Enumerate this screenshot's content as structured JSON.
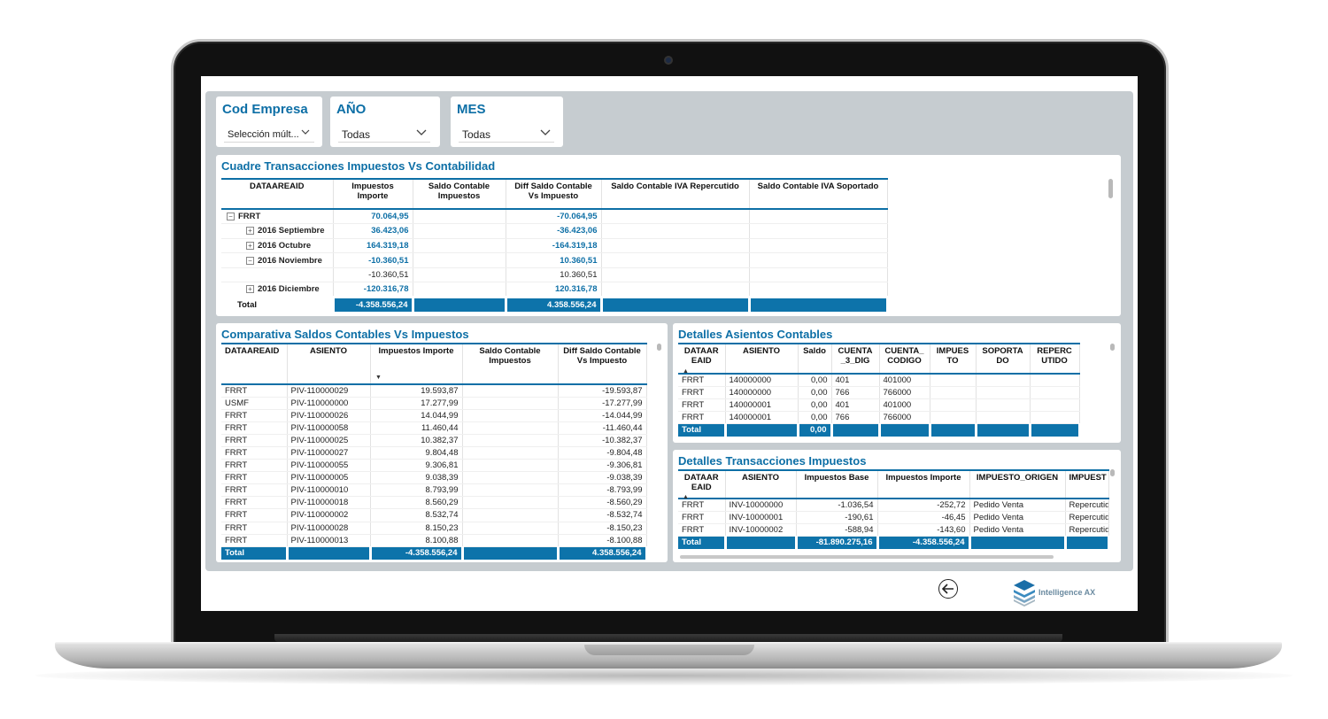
{
  "slicers": {
    "empresa": {
      "title": "Cod Empresa",
      "value": "Selección múlt..."
    },
    "anio": {
      "title": "AÑO",
      "value": "Todas"
    },
    "mes": {
      "title": "MES",
      "value": "Todas"
    }
  },
  "cuadre": {
    "title": "Cuadre Transacciones Impuestos Vs Contabilidad",
    "headers": [
      "DATAAREAID",
      "Impuestos Importe",
      "Saldo Contable Impuestos",
      "Diff Saldo Contable Vs Impuesto",
      "Saldo Contable IVA Repercutido",
      "Saldo Contable IVA Soportado"
    ],
    "rows": [
      {
        "label": "FRRT",
        "expander": "⊟",
        "indent": 0,
        "importe": "70.064,95",
        "diff": "-70.064,95",
        "bold": true
      },
      {
        "label": "2016 Septiembre",
        "expander": "⊞",
        "indent": 1,
        "importe": "36.423,06",
        "diff": "-36.423,06",
        "bold": true
      },
      {
        "label": "2016 Octubre",
        "expander": "⊞",
        "indent": 1,
        "importe": "164.319,18",
        "diff": "-164.319,18",
        "bold": true
      },
      {
        "label": "2016 Noviembre",
        "expander": "⊟",
        "indent": 1,
        "importe": "-10.360,51",
        "diff": "10.360,51",
        "bold": true
      },
      {
        "label": "",
        "expander": "",
        "indent": 2,
        "importe": "-10.360,51",
        "diff": "10.360,51",
        "bold": false
      },
      {
        "label": "2016 Diciembre",
        "expander": "⊞",
        "indent": 1,
        "importe": "-120.316,78",
        "diff": "120.316,78",
        "bold": true
      }
    ],
    "total": {
      "label": "Total",
      "importe": "-4.358.556,24",
      "diff": "4.358.556,24"
    }
  },
  "comparativa": {
    "title": "Comparativa Saldos Contables Vs Impuestos",
    "headers": [
      "DATAAREAID",
      "ASIENTO",
      "Impuestos Importe",
      "Saldo Contable Impuestos",
      "Diff Saldo Contable Vs Impuesto"
    ],
    "rows": [
      [
        "FRRT",
        "PIV-110000029",
        "19.593,87",
        "",
        "-19.593,87"
      ],
      [
        "USMF",
        "PIV-110000000",
        "17.277,99",
        "",
        "-17.277,99"
      ],
      [
        "FRRT",
        "PIV-110000026",
        "14.044,99",
        "",
        "-14.044,99"
      ],
      [
        "FRRT",
        "PIV-110000058",
        "11.460,44",
        "",
        "-11.460,44"
      ],
      [
        "FRRT",
        "PIV-110000025",
        "10.382,37",
        "",
        "-10.382,37"
      ],
      [
        "FRRT",
        "PIV-110000027",
        "9.804,48",
        "",
        "-9.804,48"
      ],
      [
        "FRRT",
        "PIV-110000055",
        "9.306,81",
        "",
        "-9.306,81"
      ],
      [
        "FRRT",
        "PIV-110000005",
        "9.038,39",
        "",
        "-9.038,39"
      ],
      [
        "FRRT",
        "PIV-110000010",
        "8.793,99",
        "",
        "-8.793,99"
      ],
      [
        "FRRT",
        "PIV-110000018",
        "8.560,29",
        "",
        "-8.560,29"
      ],
      [
        "FRRT",
        "PIV-110000002",
        "8.532,74",
        "",
        "-8.532,74"
      ],
      [
        "FRRT",
        "PIV-110000028",
        "8.150,23",
        "",
        "-8.150,23"
      ],
      [
        "FRRT",
        "PIV-110000013",
        "8.100,88",
        "",
        "-8.100,88"
      ]
    ],
    "total": [
      "Total",
      "",
      "-4.358.556,24",
      "",
      "4.358.556,24"
    ]
  },
  "asientos": {
    "title": "Detalles Asientos Contables",
    "headers": [
      "DATAAR EAID",
      "ASIENTO",
      "Saldo",
      "CUENTA _3_DIG",
      "CUENTA_ CODIGO",
      "IMPUES TO",
      "SOPORTA DO",
      "REPERC UTIDO"
    ],
    "rows": [
      [
        "FRRT",
        "140000000",
        "0,00",
        "401",
        "401000",
        "",
        "",
        ""
      ],
      [
        "FRRT",
        "140000000",
        "0,00",
        "766",
        "766000",
        "",
        "",
        ""
      ],
      [
        "FRRT",
        "140000001",
        "0,00",
        "401",
        "401000",
        "",
        "",
        ""
      ],
      [
        "FRRT",
        "140000001",
        "0,00",
        "766",
        "766000",
        "",
        "",
        ""
      ]
    ],
    "total": [
      "Total",
      "",
      "0,00",
      "",
      "",
      "",
      "",
      ""
    ]
  },
  "transacciones": {
    "title": "Detalles Transacciones Impuestos",
    "headers": [
      "DATAAR EAID",
      "ASIENTO",
      "Impuestos Base",
      "Impuestos Importe",
      "IMPUESTO_ORIGEN",
      "IMPUEST"
    ],
    "rows": [
      [
        "FRRT",
        "INV-10000000",
        "-1.036,54",
        "-252,72",
        "Pedido Venta",
        "Repercutido"
      ],
      [
        "FRRT",
        "INV-10000001",
        "-190,61",
        "-46,45",
        "Pedido Venta",
        "Repercutido"
      ],
      [
        "FRRT",
        "INV-10000002",
        "-588,94",
        "-143,60",
        "Pedido Venta",
        "Repercutido"
      ]
    ],
    "total": [
      "Total",
      "",
      "-81.890.275,16",
      "-4.358.556,24",
      "",
      ""
    ]
  },
  "footer": {
    "logo_text": "Intelligence AX",
    "back_icon": "arrow-left-circle-icon"
  },
  "colors": {
    "accent": "#0d73aa",
    "title": "#0d6fa6",
    "canvas": "#c6ccd0"
  }
}
